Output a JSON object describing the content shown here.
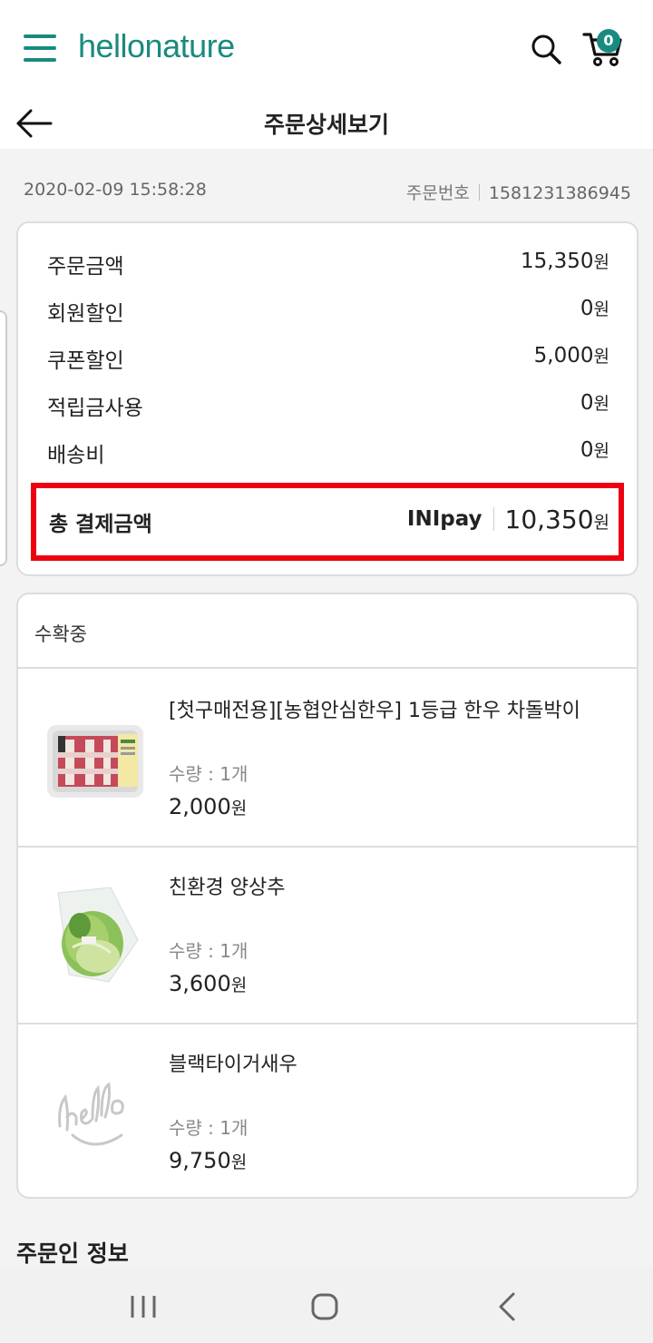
{
  "header": {
    "logo": "hellonature",
    "cart_count": "0"
  },
  "title_bar": {
    "title": "주문상세보기"
  },
  "order": {
    "date": "2020-02-09 15:58:28",
    "order_no_label": "주문번호",
    "order_no": "1581231386945"
  },
  "summary": {
    "currency": "원",
    "rows": [
      {
        "label": "주문금액",
        "value": "15,350"
      },
      {
        "label": "회원할인",
        "value": "0"
      },
      {
        "label": "쿠폰할인",
        "value": "5,000"
      },
      {
        "label": "적립금사용",
        "value": "0"
      },
      {
        "label": "배송비",
        "value": "0"
      }
    ],
    "total": {
      "label": "총 결제금액",
      "method": "INIpay",
      "amount": "10,350"
    }
  },
  "items": {
    "status": "수확중",
    "qty_label": "수량 : ",
    "list": [
      {
        "name": "[첫구매전용][농협안심한우] 1등급 한우 차돌박이",
        "qty": "1개",
        "price": "2,000",
        "thumb": "beef-package-image"
      },
      {
        "name": "친환경 양상추",
        "qty": "1개",
        "price": "3,600",
        "thumb": "lettuce-image"
      },
      {
        "name": "블랙타이거새우",
        "qty": "1개",
        "price": "9,750",
        "thumb": "hello-placeholder-logo"
      }
    ]
  },
  "orderer": {
    "title": "주문인 정보"
  },
  "colors": {
    "brand": "#1a8a7e",
    "highlight": "#ee0011"
  }
}
